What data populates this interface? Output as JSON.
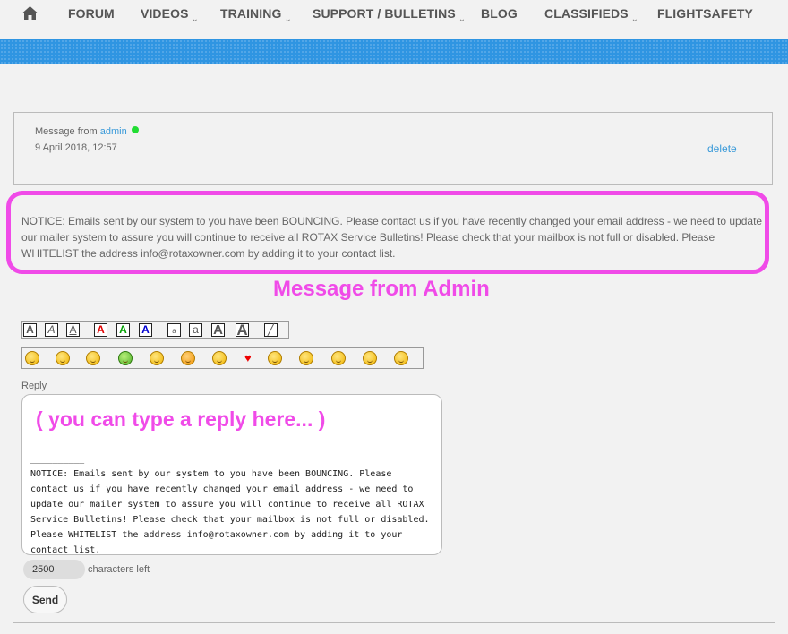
{
  "nav": {
    "items": [
      {
        "label": "FORUM",
        "dropdown": false
      },
      {
        "label": "VIDEOS",
        "dropdown": true
      },
      {
        "label": "TRAINING",
        "dropdown": true
      },
      {
        "label": "SUPPORT / BULLETINS",
        "dropdown": true
      },
      {
        "label": "BLOG",
        "dropdown": false
      },
      {
        "label": "CLASSIFIEDS",
        "dropdown": true
      },
      {
        "label": "FLIGHTSAFETY",
        "dropdown": false
      }
    ],
    "chevron": "⌄",
    "band_color": "#2f95e2"
  },
  "message": {
    "from_prefix": "Message from",
    "from_user": "admin",
    "online_color": "#22dd33",
    "date": "9 April 2018, 12:57",
    "delete_label": "delete",
    "body": "NOTICE: Emails sent by our system to you have been BOUNCING. Please contact us if you have recently changed your email address - we need to update our mailer system to assure you will continue to receive all ROTAX Service Bulletins! Please check that your mailbox is not full or disabled. Please WHITELIST the address info@rotaxowner.com by adding it to your contact list."
  },
  "annotations": {
    "message_caption": "Message from Admin",
    "reply_caption": "( you can type a reply here... )",
    "highlight_color": "#f04be8"
  },
  "format_toolbar": {
    "buttons": [
      {
        "glyph": "A",
        "icon": "bold-icon"
      },
      {
        "glyph": "A",
        "icon": "italic-icon"
      },
      {
        "glyph": "A",
        "icon": "underline-icon"
      },
      {
        "glyph": "A",
        "icon": "red-text-icon",
        "color": "#e00000"
      },
      {
        "glyph": "A",
        "icon": "green-text-icon",
        "color": "#00a000"
      },
      {
        "glyph": "A",
        "icon": "blue-text-icon",
        "color": "#0000d0"
      },
      {
        "glyph": "a",
        "icon": "small-text-icon"
      },
      {
        "glyph": "a",
        "icon": "normal-text-icon"
      },
      {
        "glyph": "A",
        "icon": "large-text-icon"
      },
      {
        "glyph": "A",
        "icon": "huge-text-icon"
      },
      {
        "glyph": "╱",
        "icon": "strike-icon"
      }
    ]
  },
  "emoji_toolbar": {
    "items": [
      "smile-emoji-icon",
      "sad-emoji-icon",
      "tongue-emoji-icon",
      "sick-emoji-icon",
      "angry-emoji-icon",
      "surprised-emoji-icon",
      "cool-emoji-icon",
      "heart-emoji-icon",
      "neutral-emoji-icon",
      "grin-emoji-icon",
      "shocked-emoji-icon",
      "wink-emoji-icon",
      "confused-emoji-icon"
    ]
  },
  "reply": {
    "label": "Reply",
    "value": "__________\nNOTICE: Emails sent by our system to you have been BOUNCING. Please contact us if you have recently changed your email address - we need to update our mailer system to assure you will continue to receive all ROTAX Service Bulletins! Please check that your mailbox is not full or disabled. Please WHITELIST the address info@rotaxowner.com by adding it to your contact list.",
    "chars_left": "2500",
    "chars_left_label": "characters left",
    "send_label": "Send"
  }
}
